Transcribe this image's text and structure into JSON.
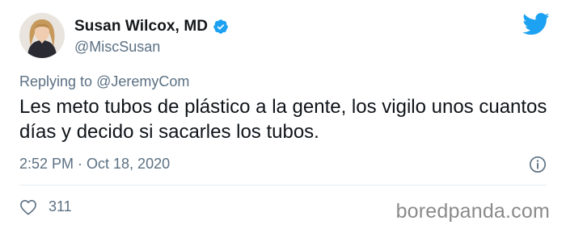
{
  "tweet": {
    "display_name": "Susan Wilcox, MD",
    "handle": "@MiscSusan",
    "verified": true,
    "replying_prefix": "Replying to ",
    "replying_to": "@JeremyCom",
    "text": "Les meto tubos de plástico a la gente, los vigilo unos cuantos días y decido si sacarles los tubos.",
    "timestamp": "2:52 PM · Oct 18, 2020",
    "like_count": "311"
  },
  "icons": {
    "verified": "verified-badge-icon",
    "twitter": "twitter-bird-icon",
    "info": "info-icon",
    "like": "heart-icon"
  },
  "colors": {
    "twitter_blue": "#1da1f2",
    "secondary_text": "#5b7083",
    "primary_text": "#0f1419",
    "watermark": "#8a8a8a"
  },
  "watermark": {
    "text": "boredpanda.com"
  }
}
